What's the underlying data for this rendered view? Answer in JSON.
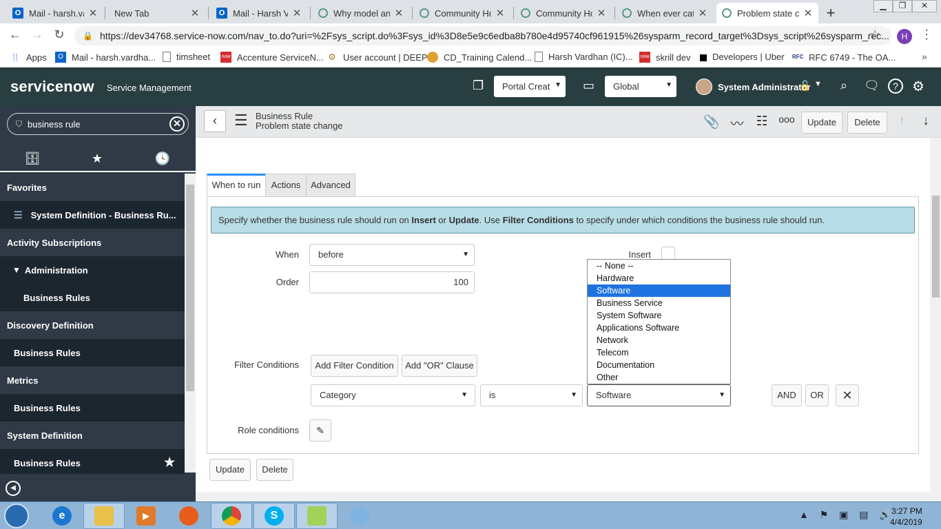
{
  "browser": {
    "tabs": [
      {
        "title": "Mail - harsh.var",
        "icon": "outlook-icon"
      },
      {
        "title": "New Tab",
        "icon": ""
      },
      {
        "title": "Mail - Harsh Va",
        "icon": "outlook-icon"
      },
      {
        "title": "Why model and",
        "icon": "community-icon"
      },
      {
        "title": "Community Ho",
        "icon": "community-icon"
      },
      {
        "title": "Community Ho",
        "icon": "community-icon"
      },
      {
        "title": "When ever cate",
        "icon": "community-icon"
      },
      {
        "title": "Problem state c",
        "icon": "community-icon"
      }
    ],
    "url": "https://dev34768.service-now.com/nav_to.do?uri=%2Fsys_script.do%3Fsys_id%3D8e5e9c6edba8b780e4d95740cf961915%26sysparm_record_target%3Dsys_script%26sysparm_rec...",
    "profile_initial": "H",
    "bookmarks": [
      "Apps",
      "Mail - harsh.vardha...",
      "timsheet",
      "Accenture ServiceN...",
      "User account | DEEP",
      "CD_Training Calend...",
      "Harsh Vardhan (IC)...",
      "skrill dev",
      "Developers | Uber",
      "RFC 6749 - The OA..."
    ]
  },
  "header": {
    "logo": "servicenow",
    "subtitle": "Service Management",
    "app_select": "Portal Creat",
    "scope_select": "Global",
    "user": "System Administrator"
  },
  "leftnav": {
    "filter_value": "business rule",
    "items": [
      {
        "label": "Favorites",
        "kind": "section"
      },
      {
        "label": "System Definition - Business Ru...",
        "kind": "module"
      },
      {
        "label": "Activity Subscriptions",
        "kind": "section"
      },
      {
        "label": "Administration",
        "kind": "module"
      },
      {
        "label": "Business Rules",
        "kind": "module2"
      },
      {
        "label": "Discovery Definition",
        "kind": "section"
      },
      {
        "label": "Business Rules",
        "kind": "module"
      },
      {
        "label": "Metrics",
        "kind": "section"
      },
      {
        "label": "Business Rules",
        "kind": "module"
      },
      {
        "label": "System Definition",
        "kind": "section"
      },
      {
        "label": "Business Rules",
        "kind": "module"
      }
    ]
  },
  "form": {
    "header_title": "Business Rule",
    "header_record": "Problem state change",
    "update_label": "Update",
    "delete_label": "Delete",
    "tabs": [
      "When to run",
      "Actions",
      "Advanced"
    ],
    "info_parts": [
      "Specify whether the business rule should run on ",
      "Insert",
      " or ",
      "Update",
      ". Use ",
      "Filter Conditions",
      " to specify under which conditions the business rule should run."
    ],
    "when_label": "When",
    "when_value": "before",
    "order_label": "Order",
    "order_value": "100",
    "insert_label": "Insert",
    "filter_label": "Filter Conditions",
    "add_filter_label": "Add Filter Condition",
    "add_or_label": "Add \"OR\" Clause",
    "condition_field": "Category",
    "condition_operator": "is",
    "condition_value": "Software",
    "and_label": "AND",
    "or_label": "OR",
    "role_label": "Role conditions",
    "dropdown_options": [
      "-- None --",
      "Hardware",
      "Software",
      "Business Service",
      "System Software",
      "Applications Software",
      "Network",
      "Telecom",
      "Documentation",
      "Other"
    ],
    "dropdown_selected": "Software"
  },
  "taskbar": {
    "time": "3:27 PM",
    "date": "4/4/2019"
  }
}
